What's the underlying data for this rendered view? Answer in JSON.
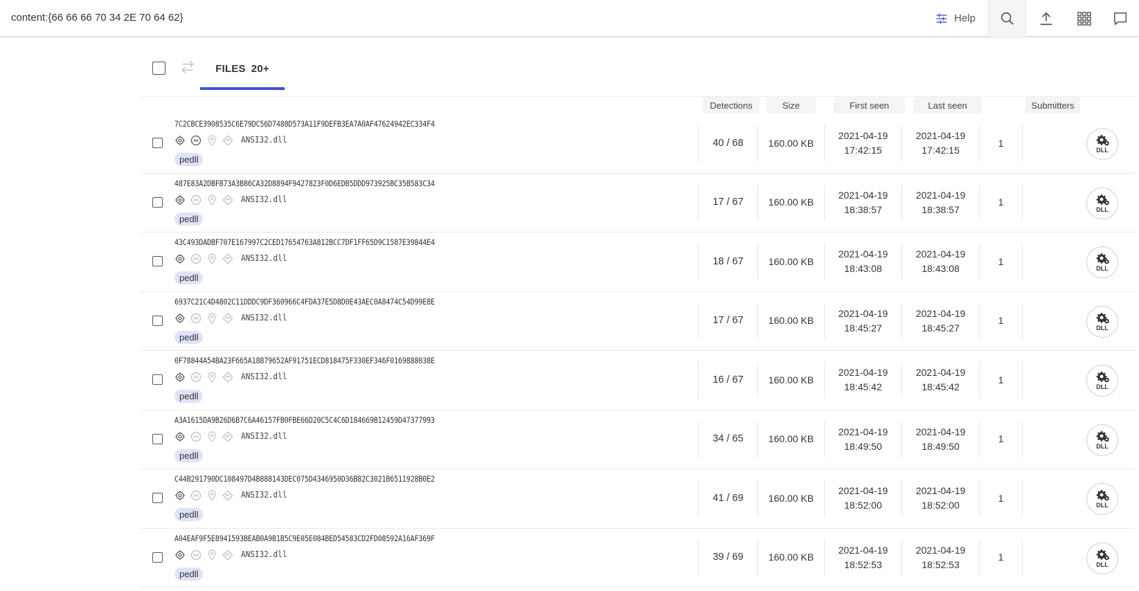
{
  "topbar": {
    "query": "content:{66 66 66 70 34 2E 70 64 62}",
    "help_label": "Help",
    "icons": [
      "filter-icon",
      "search-icon",
      "upload-icon",
      "apps-grid-icon",
      "chat-icon"
    ]
  },
  "tabs": {
    "files_label": "FILES",
    "files_count": "20+"
  },
  "columns": {
    "detections": "Detections",
    "size": "Size",
    "first_seen": "First seen",
    "last_seen": "Last seen",
    "submitters": "Submitters"
  },
  "colors": {
    "accent": "#3f51d9",
    "tag_bg": "#dfe3f7"
  },
  "rows": [
    {
      "hash": "7C2CBCE3908535C6E79DC56D7488D573A11F9DEFB3EA7A0AF47624942EC334F4",
      "name": "ANSI32.dll",
      "tag": "pedll",
      "detections": "40 / 68",
      "size": "160.00 KB",
      "first_date": "2021-04-19",
      "first_time": "17:42:15",
      "last_date": "2021-04-19",
      "last_time": "17:42:15",
      "submitters": "1",
      "filetype": "DLL"
    },
    {
      "hash": "487E83A2DBFB73A3B86CA32D8894F9427823F0D6EDB5DDD973925BC35B583C34",
      "name": "ANSI32.dll",
      "tag": "pedll",
      "detections": "17 / 67",
      "size": "160.00 KB",
      "first_date": "2021-04-19",
      "first_time": "18:38:57",
      "last_date": "2021-04-19",
      "last_time": "18:38:57",
      "submitters": "1",
      "filetype": "DLL"
    },
    {
      "hash": "43C493DADBF707E167997C2CED17654763A812BCC7DF1FF65D9C1587E39844E4",
      "name": "ANSI32.dll",
      "tag": "pedll",
      "detections": "18 / 67",
      "size": "160.00 KB",
      "first_date": "2021-04-19",
      "first_time": "18:43:08",
      "last_date": "2021-04-19",
      "last_time": "18:43:08",
      "submitters": "1",
      "filetype": "DLL"
    },
    {
      "hash": "6937C21C4D4802C11DDDC9DF360966C4FDA37E5D8D0E43AEC0A8474C54D99E8E",
      "name": "ANSI32.dll",
      "tag": "pedll",
      "detections": "17 / 67",
      "size": "160.00 KB",
      "first_date": "2021-04-19",
      "first_time": "18:45:27",
      "last_date": "2021-04-19",
      "last_time": "18:45:27",
      "submitters": "1",
      "filetype": "DLL"
    },
    {
      "hash": "0F78844A54BA23F665A18B79652AF91751ECD818475F330EF346F0169888038E",
      "name": "ANSI32.dll",
      "tag": "pedll",
      "detections": "16 / 67",
      "size": "160.00 KB",
      "first_date": "2021-04-19",
      "first_time": "18:45:42",
      "last_date": "2021-04-19",
      "last_time": "18:45:42",
      "submitters": "1",
      "filetype": "DLL"
    },
    {
      "hash": "A3A1615DA9B26D6B7C6A46157FB0FBE66D20C5C4C6D184669B12459D47377993",
      "name": "ANSI32.dll",
      "tag": "pedll",
      "detections": "34 / 65",
      "size": "160.00 KB",
      "first_date": "2021-04-19",
      "first_time": "18:49:50",
      "last_date": "2021-04-19",
      "last_time": "18:49:50",
      "submitters": "1",
      "filetype": "DLL"
    },
    {
      "hash": "C44B291790DC108497D4B888143DEC075D4346950D36B82C3021B6511928B0E2",
      "name": "ANSI32.dll",
      "tag": "pedll",
      "detections": "41 / 69",
      "size": "160.00 KB",
      "first_date": "2021-04-19",
      "first_time": "18:52:00",
      "last_date": "2021-04-19",
      "last_time": "18:52:00",
      "submitters": "1",
      "filetype": "DLL"
    },
    {
      "hash": "A04EAF9F5E8941593BEAB0A9B1B5C9E05E084BED54583CD2FD08592A16AF369F",
      "name": "ANSI32.dll",
      "tag": "pedll",
      "detections": "39 / 69",
      "size": "160.00 KB",
      "first_date": "2021-04-19",
      "first_time": "18:52:53",
      "last_date": "2021-04-19",
      "last_time": "18:52:53",
      "submitters": "1",
      "filetype": "DLL"
    }
  ]
}
